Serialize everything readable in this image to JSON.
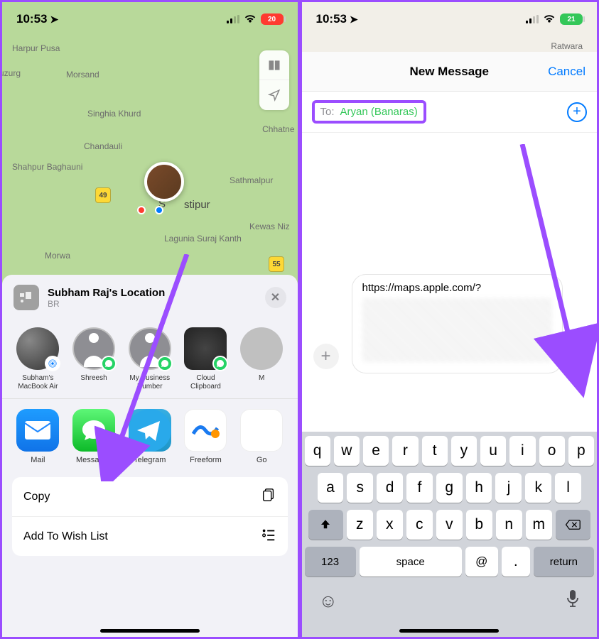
{
  "left": {
    "status": {
      "time": "10:53",
      "battery": "20"
    },
    "map": {
      "labels": {
        "harpur": "Harpur Pusa",
        "sathmalpur": "Sathmalpur",
        "morsand": "Morsand",
        "buzurg": "a Buzurg",
        "singhia": "Singhia Khurd",
        "chandauli": "Chandauli",
        "shahpur": "Shahpur Baghauni",
        "morwa": "Morwa",
        "lagunia": "Lagunia Suraj Kanth",
        "kewas": "Kewas Niz",
        "stipur": "stipur",
        "chhatne": "Chhatne",
        "s": "S",
        "r49": "49",
        "r55": "55"
      }
    },
    "sheet": {
      "title": "Subham Raj's Location",
      "subtitle": "BR",
      "contacts": [
        {
          "label": "Subham's MacBook Air"
        },
        {
          "label": "Shreesh"
        },
        {
          "label": "My Business Number"
        },
        {
          "label": "Cloud Clipboard"
        },
        {
          "label": "M"
        }
      ],
      "apps": [
        {
          "label": "Mail"
        },
        {
          "label": "Messages"
        },
        {
          "label": "Telegram"
        },
        {
          "label": "Freeform"
        },
        {
          "label": "Go"
        }
      ],
      "actions": {
        "copy": "Copy",
        "wishlist": "Add To Wish List"
      }
    }
  },
  "right": {
    "status": {
      "time": "10:53",
      "battery": "21"
    },
    "map": {
      "labels": {
        "ratwara": "Ratwara"
      }
    },
    "nav": {
      "title": "New Message",
      "cancel": "Cancel"
    },
    "compose": {
      "to_label": "To:",
      "recipient": "Aryan (Banaras)",
      "message_link": "https://maps.apple.com/?"
    },
    "keyboard": {
      "row1": [
        "q",
        "w",
        "e",
        "r",
        "t",
        "y",
        "u",
        "i",
        "o",
        "p"
      ],
      "row2": [
        "a",
        "s",
        "d",
        "f",
        "g",
        "h",
        "j",
        "k",
        "l"
      ],
      "row3": [
        "z",
        "x",
        "c",
        "v",
        "b",
        "n",
        "m"
      ],
      "bottom": {
        "num": "123",
        "space": "space",
        "at": "@",
        "dot": ".",
        "return": "return"
      }
    }
  }
}
